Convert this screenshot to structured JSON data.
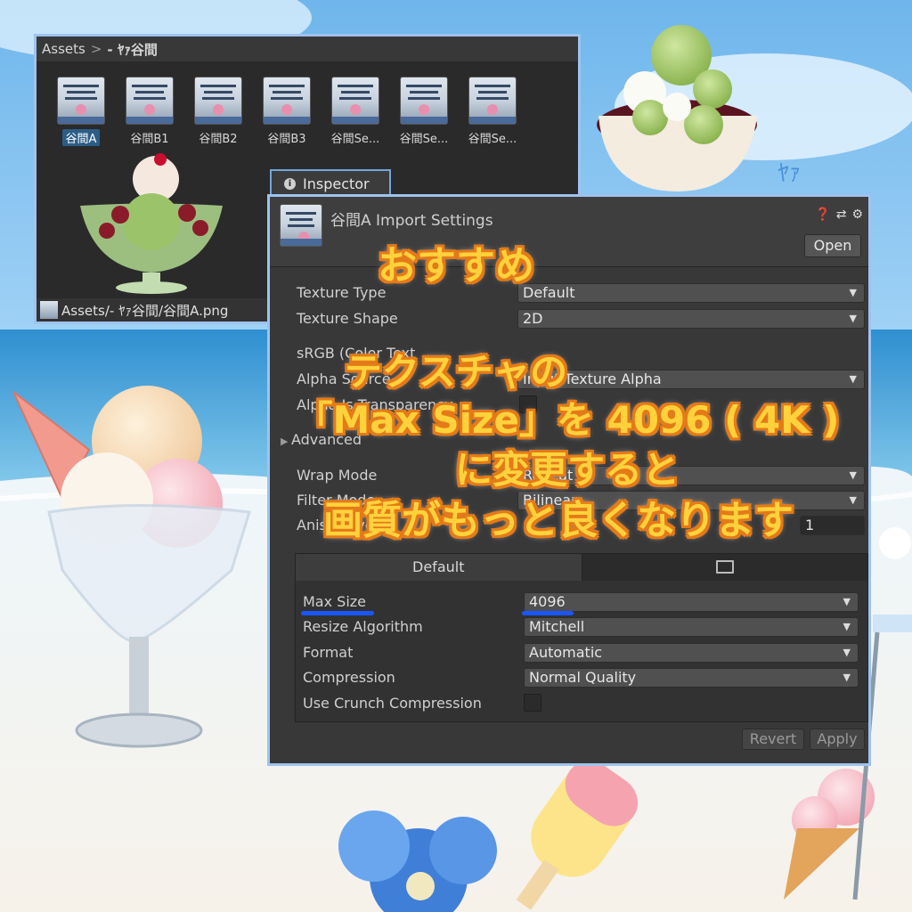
{
  "project": {
    "breadcrumb_root": "Assets",
    "breadcrumb_sep": ">",
    "breadcrumb_current": "- ﾔｧ谷間",
    "assets": [
      {
        "label": "谷間A",
        "selected": true
      },
      {
        "label": "谷間B1"
      },
      {
        "label": "谷間B2"
      },
      {
        "label": "谷間B3"
      },
      {
        "label": "谷間Se..."
      },
      {
        "label": "谷間Se..."
      },
      {
        "label": "谷間Se..."
      }
    ],
    "path": "Assets/- ﾔｧ谷間/谷間A.png"
  },
  "inspector": {
    "tab_label": "Inspector",
    "title": "谷間A Import Settings",
    "open_label": "Open",
    "texture_type_label": "Texture Type",
    "texture_type_value": "Default",
    "texture_shape_label": "Texture Shape",
    "texture_shape_value": "2D",
    "srgb_label": "sRGB (Color Text",
    "alpha_source_label": "Alpha Source",
    "alpha_source_value": "Input Texture Alpha",
    "alpha_transparency_label": "Alpha Is Transparency",
    "advanced_label": "Advanced",
    "wrap_mode_label": "Wrap Mode",
    "wrap_mode_value": "Repeat",
    "filter_mode_label": "Filter Mode",
    "filter_mode_value": "Bilinear",
    "aniso_label": "Aniso Level",
    "aniso_value": "1",
    "platform_tab_default": "Default",
    "max_size_label": "Max Size",
    "max_size_value": "4096",
    "resize_label": "Resize Algorithm",
    "resize_value": "Mitchell",
    "format_label": "Format",
    "format_value": "Automatic",
    "compression_label": "Compression",
    "compression_value": "Normal Quality",
    "crunch_label": "Use Crunch Compression",
    "revert_label": "Revert",
    "apply_label": "Apply"
  },
  "caption": {
    "line1": "おすすめ",
    "line2": "テクスチャの",
    "line3": "「Max Size」を 4096 ( 4K )",
    "line4": "に変更すると",
    "line5": "画質がもっと良くなります"
  },
  "decor": {
    "watermark": "ﾔｧ"
  },
  "colors": {
    "caption_fill": "#ffd23c",
    "caption_outline": "#e57a18",
    "highlight_underline": "#1a55ff",
    "selection": "#2c5d87"
  }
}
